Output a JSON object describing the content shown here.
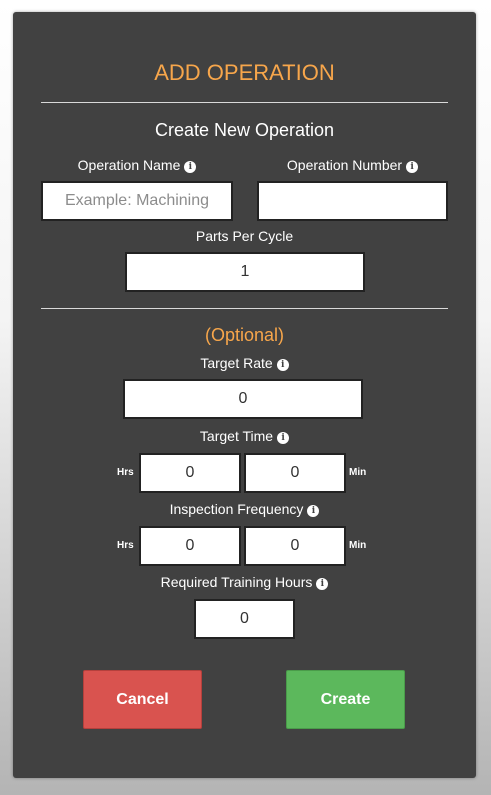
{
  "form": {
    "title": "ADD OPERATION",
    "subtitle": "Create New Operation",
    "optional_label": "(Optional)",
    "fields": {
      "operation_name": {
        "label": "Operation Name",
        "value": "",
        "placeholder": "Example: Machining",
        "info_icon": "info-circle-icon"
      },
      "operation_number": {
        "label": "Operation Number",
        "value": "",
        "placeholder": "",
        "info_icon": "info-circle-icon"
      },
      "parts_per_cycle": {
        "label": "Parts Per Cycle",
        "value": "1"
      },
      "target_rate": {
        "label": "Target Rate",
        "value": "0",
        "info_icon": "info-circle-icon"
      },
      "target_time": {
        "label": "Target Time",
        "hours_value": "0",
        "minutes_value": "0",
        "hours_unit": "Hrs",
        "minutes_unit": "Min",
        "info_icon": "info-circle-icon"
      },
      "inspection_frequency": {
        "label": "Inspection Frequency",
        "hours_value": "0",
        "minutes_value": "0",
        "hours_unit": "Hrs",
        "minutes_unit": "Min",
        "info_icon": "info-circle-icon"
      },
      "required_training_hours": {
        "label": "Required Training Hours",
        "value": "0",
        "info_icon": "info-circle-icon"
      }
    },
    "buttons": {
      "cancel": "Cancel",
      "create": "Create"
    },
    "info_glyph": "i"
  },
  "colors": {
    "panel": "#414141",
    "accent": "#f7a64b",
    "cancel": "#d9534f",
    "create": "#5cb85c"
  }
}
